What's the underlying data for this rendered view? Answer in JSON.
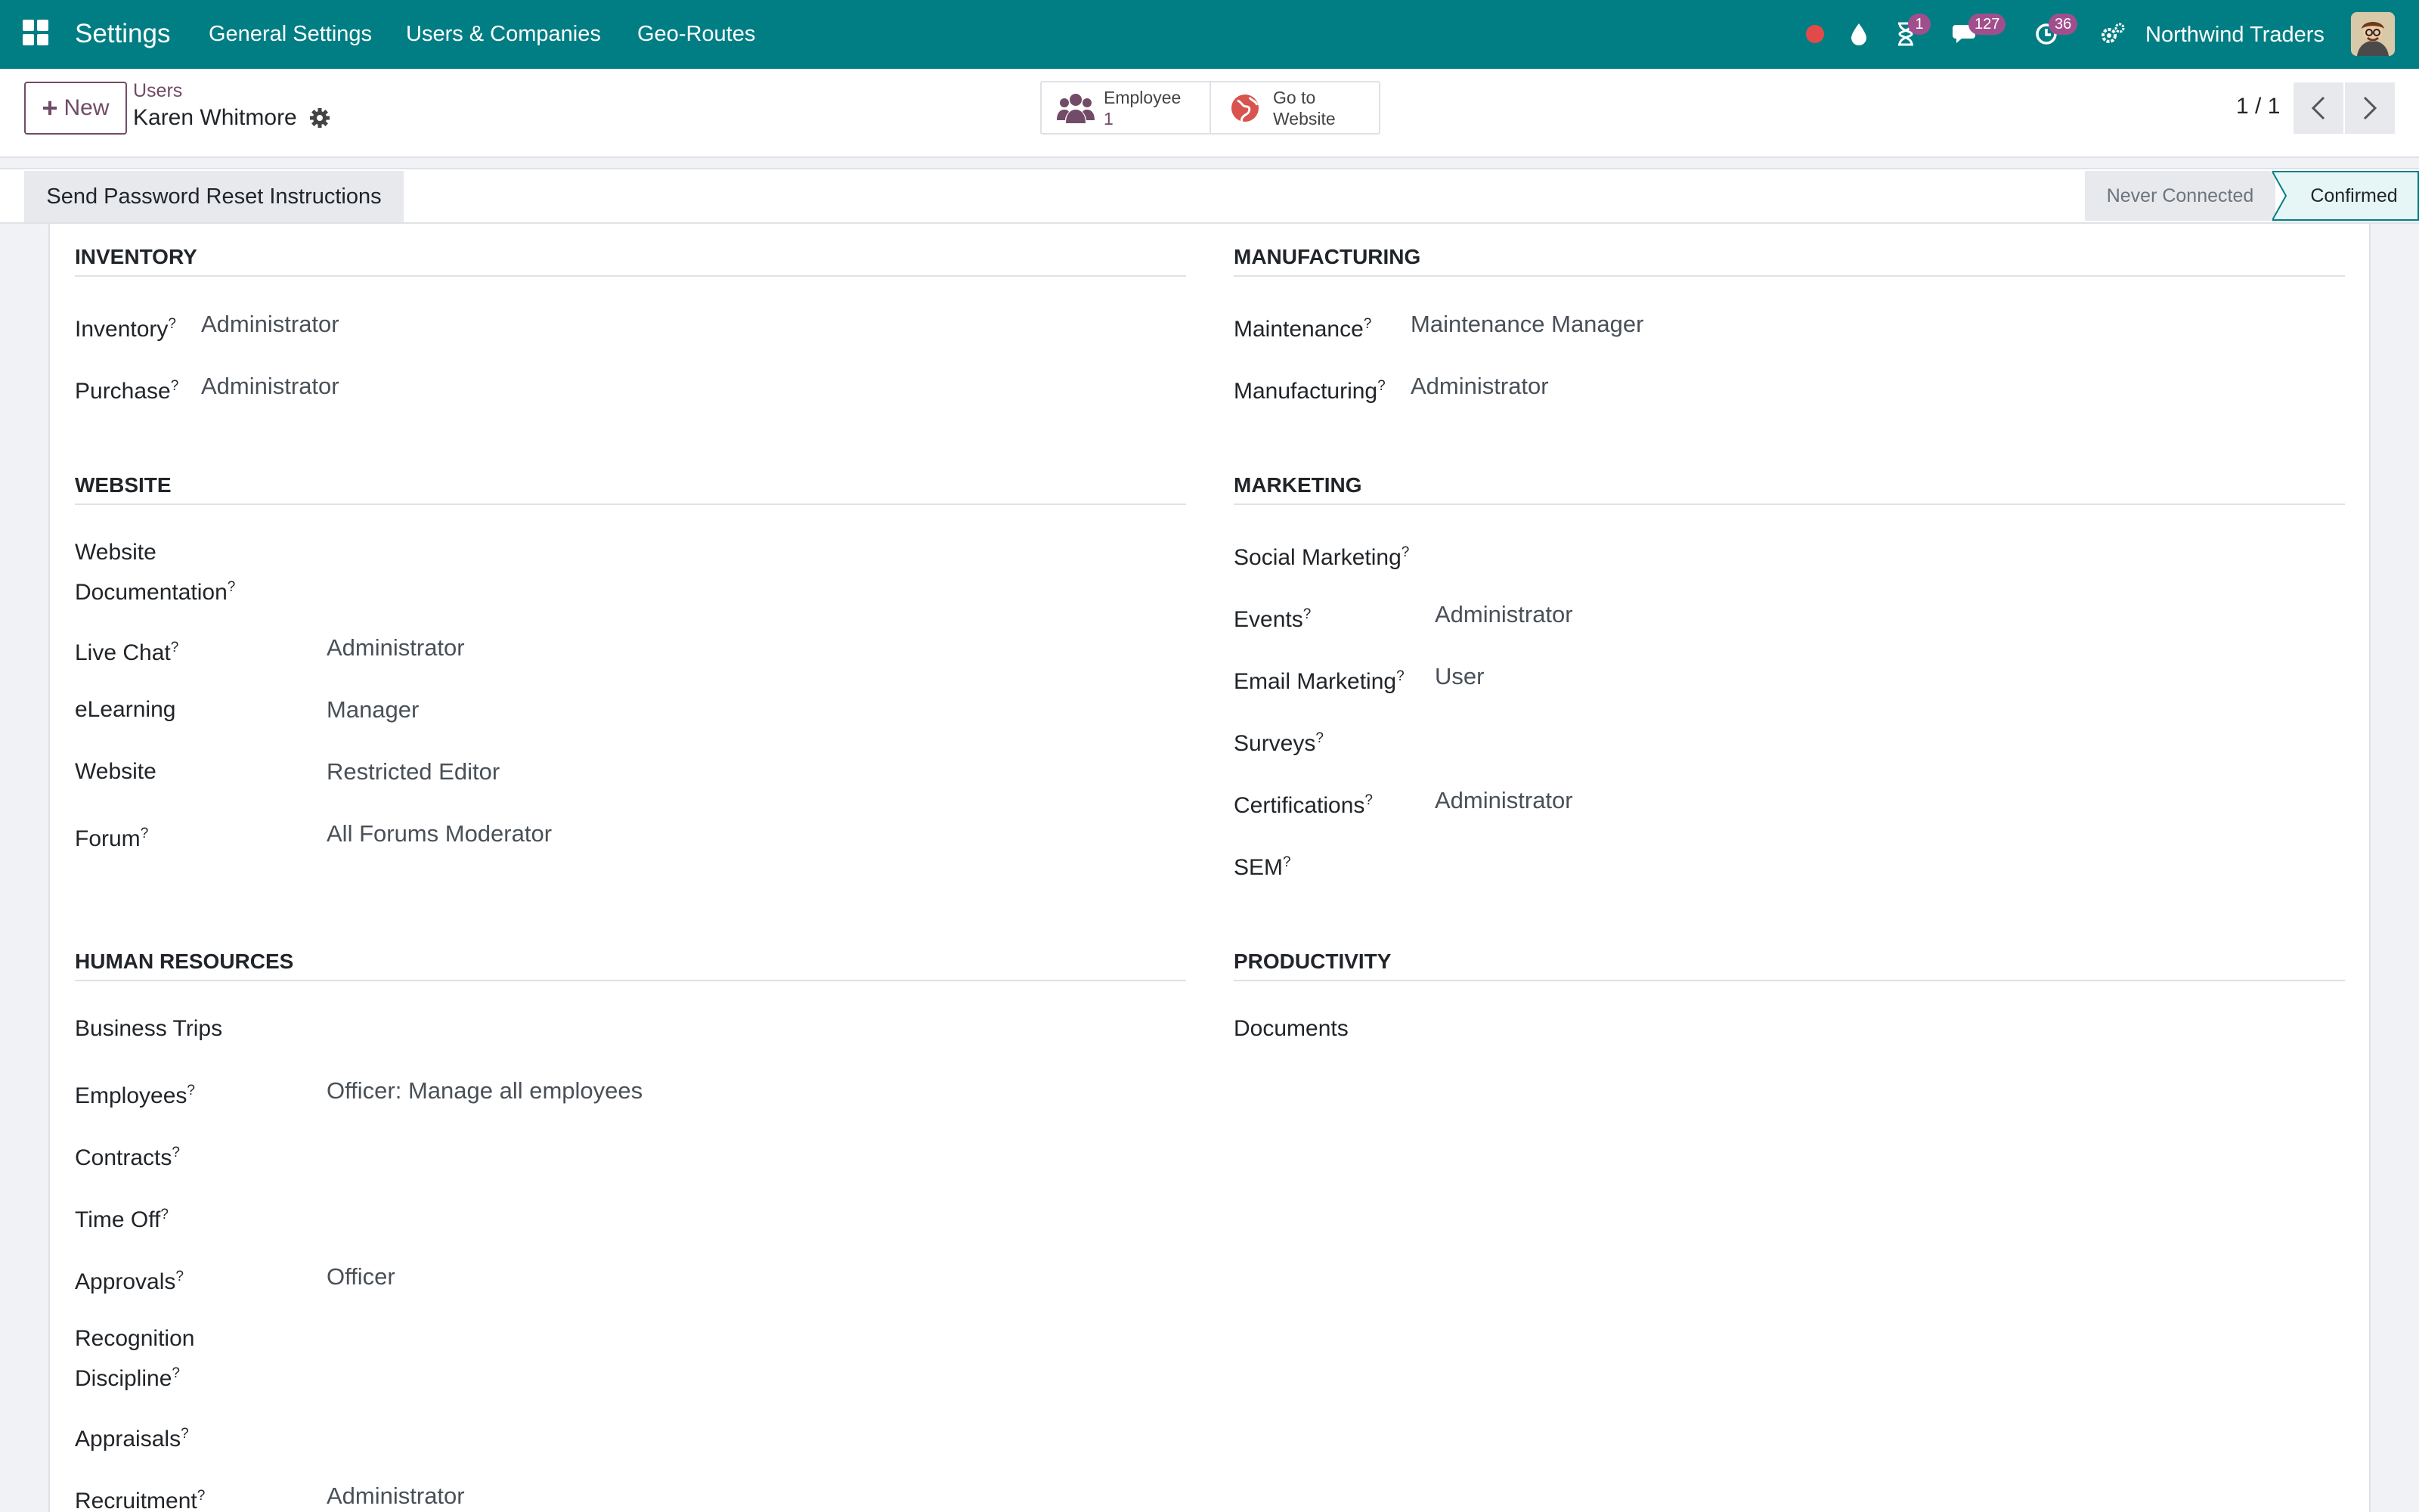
{
  "navbar": {
    "brand": "Settings",
    "menu": [
      "General Settings",
      "Users & Companies",
      "Geo-Routes"
    ],
    "badges": {
      "activities_timer": "1",
      "messages": "127",
      "activities": "36"
    },
    "company": "Northwind Traders"
  },
  "control": {
    "new_label": "New",
    "breadcrumb_parent": "Users",
    "breadcrumb_current": "Karen Whitmore",
    "smart_employee_label": "Employee",
    "smart_employee_count": "1",
    "smart_website_line1": "Go to",
    "smart_website_line2": "Website",
    "pager": "1 / 1"
  },
  "status": {
    "reset_button": "Send Password Reset Instructions",
    "stages": [
      "Never Connected",
      "Confirmed"
    ]
  },
  "groups": {
    "inventory": {
      "title": "INVENTORY",
      "fields": [
        {
          "label": "Inventory",
          "value": "Administrator"
        },
        {
          "label": "Purchase",
          "value": "Administrator"
        }
      ]
    },
    "manufacturing": {
      "title": "MANUFACTURING",
      "fields": [
        {
          "label": "Maintenance",
          "value": "Maintenance Manager"
        },
        {
          "label": "Manufacturing",
          "value": "Administrator"
        }
      ]
    },
    "website": {
      "title": "WEBSITE",
      "fields": [
        {
          "label_line1": "Website",
          "label_line2": "Documentation",
          "value": ""
        },
        {
          "label": "Live Chat",
          "value": "Administrator"
        },
        {
          "label": "eLearning",
          "value": "Manager"
        },
        {
          "label": "Website",
          "value": "Restricted Editor"
        },
        {
          "label": "Forum",
          "value": "All Forums Moderator"
        }
      ]
    },
    "marketing": {
      "title": "MARKETING",
      "fields": [
        {
          "label": "Social Marketing",
          "value": ""
        },
        {
          "label": "Events",
          "value": "Administrator"
        },
        {
          "label": "Email Marketing",
          "value": "User"
        },
        {
          "label": "Surveys",
          "value": ""
        },
        {
          "label": "Certifications",
          "value": "Administrator"
        },
        {
          "label": "SEM",
          "value": ""
        }
      ]
    },
    "hr": {
      "title": "HUMAN RESOURCES",
      "fields": [
        {
          "label": "Business Trips",
          "value": ""
        },
        {
          "label": "Employees",
          "value": "Officer: Manage all employees"
        },
        {
          "label": "Contracts",
          "value": ""
        },
        {
          "label": "Time Off",
          "value": ""
        },
        {
          "label": "Approvals",
          "value": "Officer"
        },
        {
          "label_line1": "Recognition",
          "label_line2": "Discipline",
          "value": ""
        },
        {
          "label": "Appraisals",
          "value": ""
        },
        {
          "label": "Recruitment",
          "value": "Administrator"
        }
      ]
    },
    "productivity": {
      "title": "PRODUCTIVITY",
      "fields": [
        {
          "label": "Documents",
          "value": ""
        }
      ]
    }
  },
  "help_marker": "?",
  "colors": {
    "navbar": "#017e84",
    "primary": "#714b67",
    "status_active": "#e6f6f7",
    "badge": "#a14f8c"
  }
}
